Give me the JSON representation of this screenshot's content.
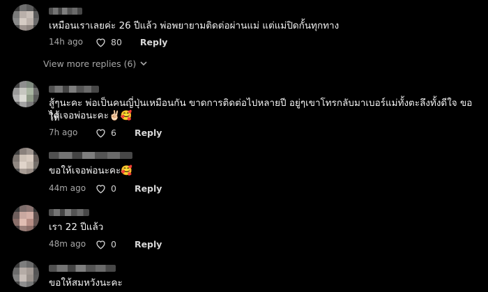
{
  "comments": [
    {
      "text": "เหมือนเราเลยค่ะ 26 ปีแล้ว พ่อพยายามติดต่อผ่านแม่ แต่แม่ปิดกั้นทุกทาง",
      "time": "14h ago",
      "likes": "80",
      "reply": "Reply"
    },
    {
      "text": "สู้ๆนะคะ พ่อเป็นคนญี่ปุ่นเหมือนกัน ขาดการติดต่อไปหลายปี อยู่ๆเขาโทรกลับมาเบอร์แม่ทั้งตะลึงทั้งดีใจ ขอให้",
      "text2": "ได้เจอพ่อนะคะ✌🏻🥰",
      "time": "7h ago",
      "likes": "6",
      "reply": "Reply"
    },
    {
      "text": "ขอให้เจอพ่อนะคะ🥰",
      "time": "44m ago",
      "likes": "0",
      "reply": "Reply"
    },
    {
      "text": "เรา 22 ปีแล้ว",
      "time": "48m ago",
      "likes": "0",
      "reply": "Reply"
    },
    {
      "text": "ขอให้สมหวังนะคะ"
    }
  ],
  "view_more": {
    "label": "View more replies (6)",
    "icon": "chevron-down-icon"
  },
  "colors": {
    "background": "#000000",
    "text": "#f2f2f2",
    "meta": "#a8a8a8"
  }
}
